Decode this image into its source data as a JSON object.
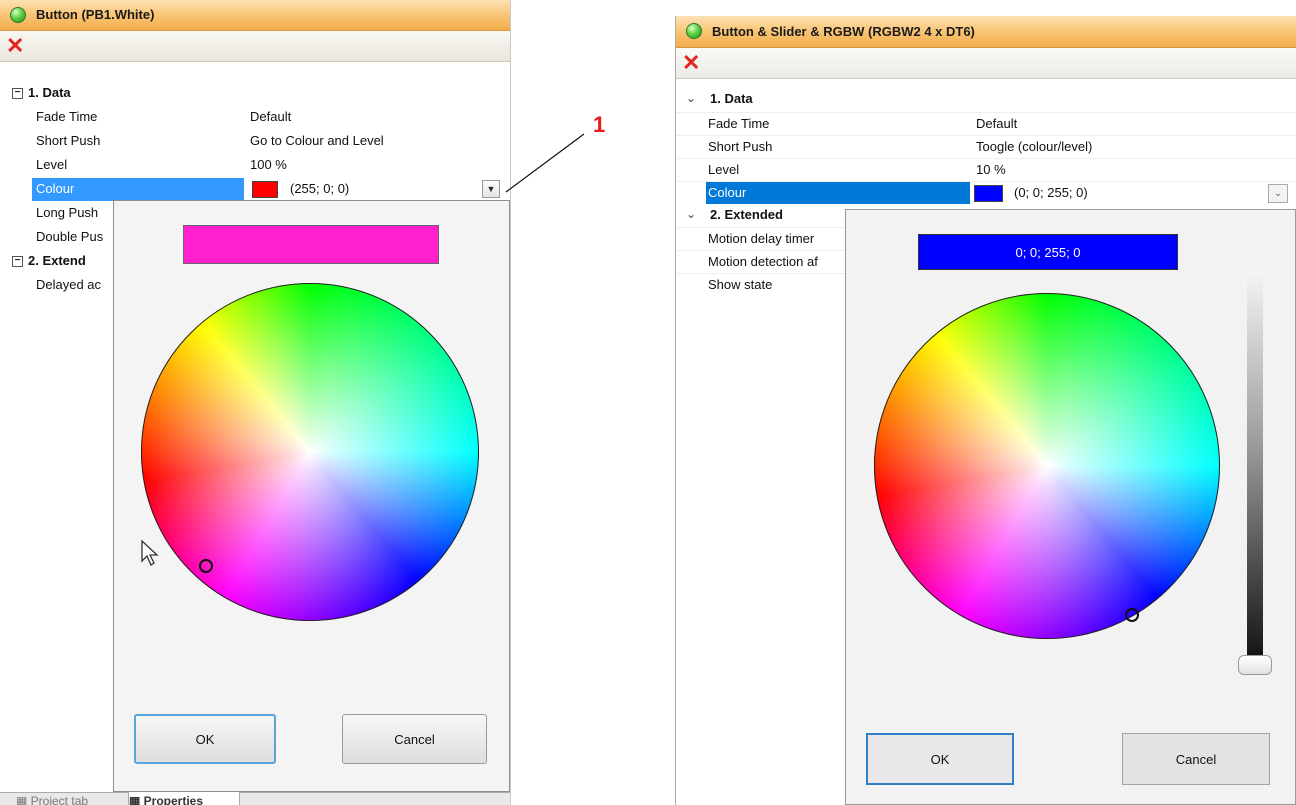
{
  "left": {
    "title": "Button (PB1.White)",
    "groups": [
      {
        "label": "1. Data"
      },
      {
        "label": "2. Extend"
      }
    ],
    "props": [
      {
        "key": "Fade Time",
        "value": "Default"
      },
      {
        "key": "Short Push",
        "value": "Go to Colour and Level"
      },
      {
        "key": "Level",
        "value": "100 %"
      },
      {
        "key": "Colour",
        "value": "(255; 0; 0)"
      },
      {
        "key": "Long Push",
        "value": ""
      },
      {
        "key": "Double Pus",
        "value": ""
      },
      {
        "key": "Delayed ac",
        "value": ""
      }
    ],
    "colour_swatch": "#ff0000",
    "preview_color": "#ff1fcf",
    "ok_label": "OK",
    "cancel_label": "Cancel",
    "bottom_tabs": [
      "Project tab",
      "Properties"
    ]
  },
  "callout": {
    "label": "1"
  },
  "right": {
    "title": "Button & Slider & RGBW (RGBW2  4 x DT6)",
    "groups": [
      {
        "label": "1. Data"
      },
      {
        "label": "2. Extended"
      }
    ],
    "props": [
      {
        "key": "Fade Time",
        "value": "Default"
      },
      {
        "key": "Short Push",
        "value": "Toogle (colour/level)"
      },
      {
        "key": "Level",
        "value": "10 %"
      },
      {
        "key": "Colour",
        "value": "(0; 0; 255; 0)"
      },
      {
        "key": "Motion delay timer",
        "value": ""
      },
      {
        "key": "Motion detection af",
        "value": ""
      },
      {
        "key": "Show state",
        "value": ""
      }
    ],
    "colour_swatch": "#0000ff",
    "preview_value": "0; 0; 255; 0",
    "preview_color": "#0000ff",
    "ok_label": "OK",
    "cancel_label": "Cancel"
  },
  "icons": {
    "status": "green-led-icon",
    "delete": "red-x-icon",
    "collapse": "minus-box-icon",
    "expand_caret": "chevron-down-icon",
    "cursor": "mouse-pointer-icon"
  }
}
